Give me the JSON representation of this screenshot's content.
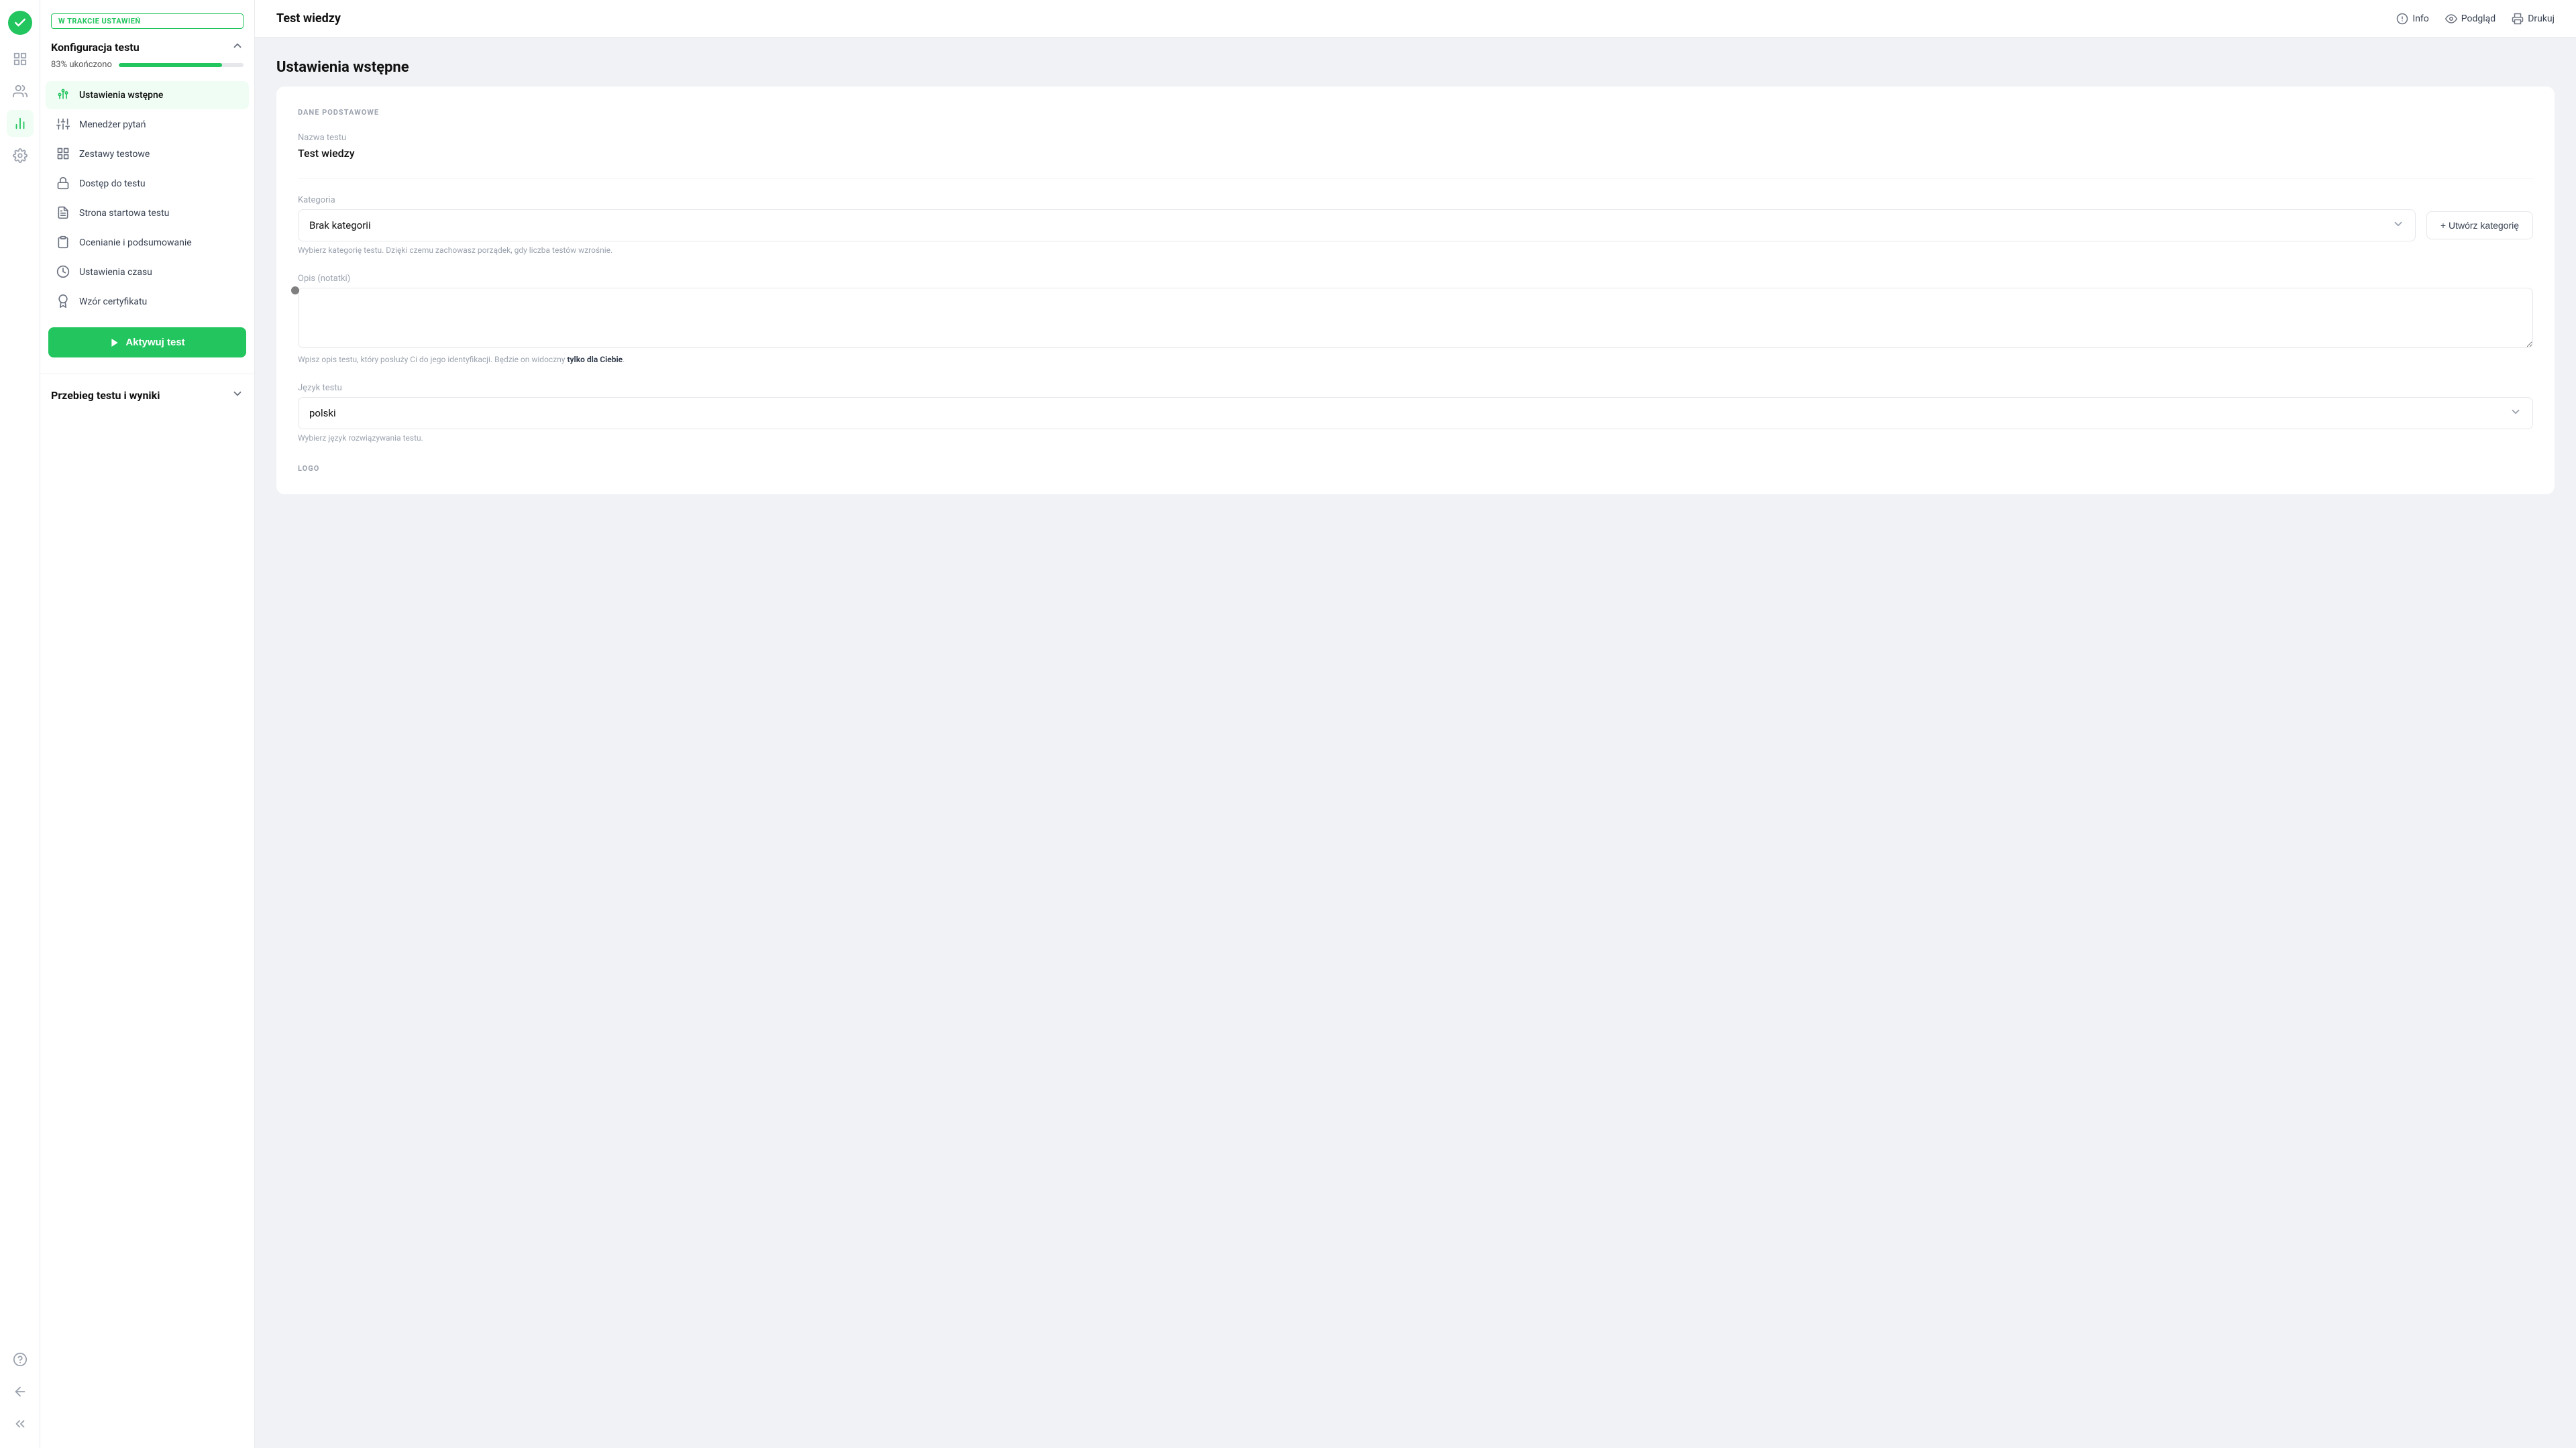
{
  "app": {
    "title": "Test wiedzy",
    "logo_icon": "check-circle"
  },
  "topbar": {
    "title": "Test wiedzy",
    "actions": [
      {
        "id": "info",
        "label": "Info",
        "icon": "info-circle"
      },
      {
        "id": "preview",
        "label": "Podgląd",
        "icon": "eye"
      },
      {
        "id": "print",
        "label": "Drukuj",
        "icon": "printer"
      }
    ]
  },
  "sidebar": {
    "status_badge": "W TRAKCIE USTAWIEŃ",
    "konfiguracja": {
      "title": "Konfiguracja testu",
      "progress_label": "83% ukończono",
      "progress_value": 83,
      "items": [
        {
          "id": "ustawienia-wstepne",
          "label": "Ustawienia wstępne",
          "icon": "settings-sliders",
          "active": true
        },
        {
          "id": "menedzer-pytan",
          "label": "Menedżer pytań",
          "icon": "sliders"
        },
        {
          "id": "zestawy-testowe",
          "label": "Zestawy testowe",
          "icon": "grid"
        },
        {
          "id": "dostep-do-testu",
          "label": "Dostęp do testu",
          "icon": "lock"
        },
        {
          "id": "strona-startowa",
          "label": "Strona startowa testu",
          "icon": "file-text"
        },
        {
          "id": "ocenianie",
          "label": "Ocenianie i podsumowanie",
          "icon": "clipboard"
        },
        {
          "id": "ustawienia-czasu",
          "label": "Ustawienia czasu",
          "icon": "clock"
        },
        {
          "id": "wzor-certyfikatu",
          "label": "Wzór certyfikatu",
          "icon": "award"
        }
      ],
      "activate_btn": "Aktywuj test"
    },
    "przebieg": {
      "title": "Przebieg testu i wyniki"
    }
  },
  "main": {
    "section_label": "DANE PODSTAWOWE",
    "page_title": "Ustawienia wstępne",
    "fields": {
      "nazwa_testu": {
        "label": "Nazwa testu",
        "value": "Test wiedzy"
      },
      "kategoria": {
        "label": "Kategoria",
        "value": "Brak kategorii",
        "hint": "Wybierz kategorię testu. Dzięki czemu zachowasz porządek, gdy liczba testów wzrośnie.",
        "create_btn": "+ Utwórz kategorię"
      },
      "opis": {
        "label": "Opis (notatki)",
        "placeholder": "",
        "hint_normal": "Wpisz opis testu, który posłuży Ci do jego identyfikacji. Będzie on widoczny ",
        "hint_bold": "tylko dla Ciebie",
        "hint_end": "."
      },
      "jezyk": {
        "label": "Język testu",
        "value": "polski",
        "hint": "Wybierz język rozwiązywania testu."
      }
    },
    "logo_section_label": "LOGO"
  },
  "rail_icons": [
    {
      "id": "home",
      "icon": "grid-four",
      "active": false
    },
    {
      "id": "users",
      "icon": "users",
      "active": false
    },
    {
      "id": "analytics",
      "icon": "bar-chart",
      "active": true
    },
    {
      "id": "settings",
      "icon": "gear",
      "active": false
    }
  ],
  "rail_bottom_icons": [
    {
      "id": "help",
      "icon": "question-circle"
    },
    {
      "id": "back",
      "icon": "arrow-left"
    },
    {
      "id": "collapse",
      "icon": "chevrons-left"
    }
  ]
}
